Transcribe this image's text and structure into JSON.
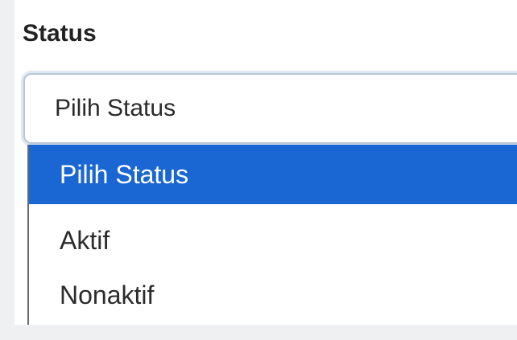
{
  "form": {
    "status_label": "Status",
    "status_select": {
      "value": "Pilih Status",
      "options": [
        {
          "label": "Pilih Status",
          "selected": true
        },
        {
          "label": "Aktif",
          "selected": false
        },
        {
          "label": "Nonaktif",
          "selected": false
        }
      ]
    }
  },
  "colors": {
    "selected_option_bg": "#1a66d2",
    "selected_option_text": "#ffffff",
    "focus_ring": "#dfe8f5",
    "select_border": "#b9c6d8",
    "page_background": "#eef0f2"
  }
}
